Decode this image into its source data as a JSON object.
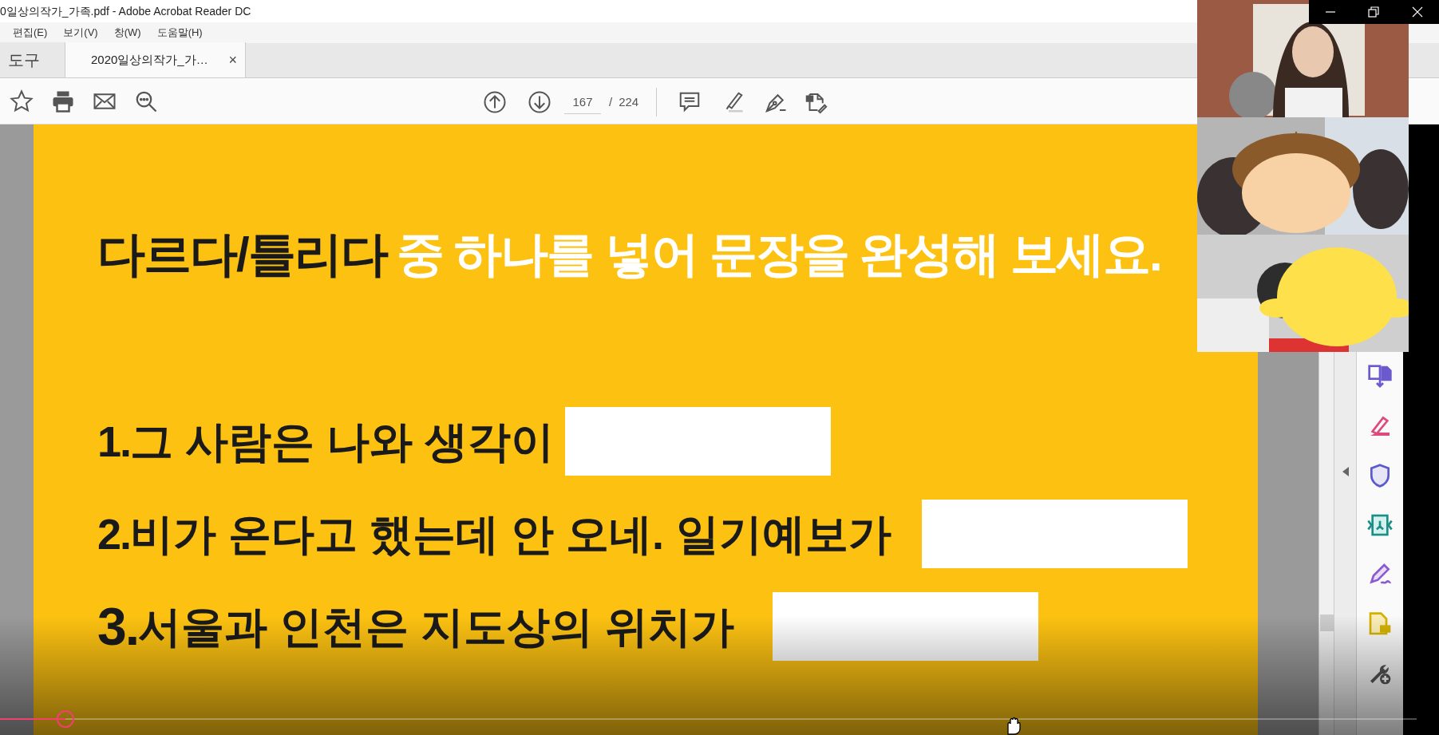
{
  "window": {
    "title": "0일상의작가_가족.pdf - Adobe Acrobat Reader DC"
  },
  "menu": [
    "편집(E)",
    "보기(V)",
    "창(W)",
    "도움말(H)"
  ],
  "tabs": [
    {
      "label": "도구",
      "selected": false,
      "kind": "home"
    },
    {
      "label": "2020일상의작가_가…",
      "selected": true,
      "kind": "document",
      "close": "×"
    }
  ],
  "pager": {
    "current": "167",
    "separator": "/",
    "total": "224"
  },
  "slide": {
    "heading": [
      {
        "text": "다르다/틀리다",
        "kind": "keyword"
      },
      {
        "text": "중 하나를 넣어 문장을 완성해 보세요.",
        "kind": "instruction"
      }
    ],
    "sentences": [
      {
        "number": "1.",
        "text": "그 사람은 나와 생각이",
        "kind": "normal"
      },
      {
        "number": "2.",
        "text": "비가 온다고 했는데 안 오네. 일기예보가",
        "kind": "normal"
      },
      {
        "number": "3.",
        "text": "서울과 인천은 지도상의 위치가",
        "kind": "large"
      }
    ]
  },
  "player": {
    "level": 0.046
  }
}
